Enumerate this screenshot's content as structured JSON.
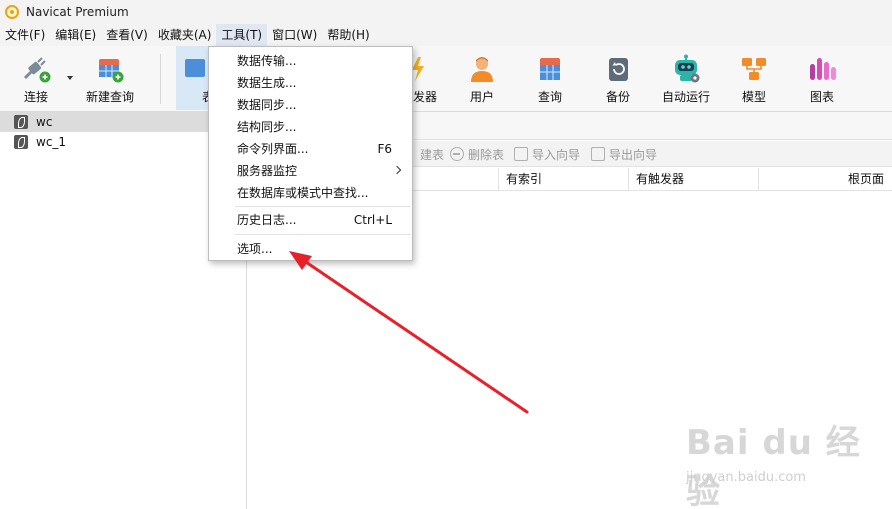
{
  "window": {
    "title": "Navicat Premium"
  },
  "menubar": {
    "items": [
      "文件(F)",
      "编辑(E)",
      "查看(V)",
      "收藏夹(A)",
      "工具(T)",
      "窗口(W)",
      "帮助(H)"
    ],
    "active_index": 4
  },
  "toolbar": {
    "buttons": [
      {
        "label": "连接",
        "icon": "connection-plug-icon"
      },
      {
        "label": "新建查询",
        "icon": "new-query-icon"
      },
      {
        "label": "表",
        "icon": "table-icon"
      },
      {
        "label": "发器",
        "icon": "trigger-icon"
      },
      {
        "label": "用户",
        "icon": "user-icon"
      },
      {
        "label": "查询",
        "icon": "query-icon"
      },
      {
        "label": "备份",
        "icon": "backup-icon"
      },
      {
        "label": "自动运行",
        "icon": "robot-icon"
      },
      {
        "label": "模型",
        "icon": "model-icon"
      },
      {
        "label": "图表",
        "icon": "chart-icon"
      }
    ]
  },
  "navigator": {
    "connections": [
      {
        "label": "wc",
        "selected": true
      },
      {
        "label": "wc_1",
        "selected": false
      }
    ]
  },
  "object_toolbar": {
    "new_table": "建表",
    "delete_table": "删除表",
    "import_wizard": "导入向导",
    "export_wizard": "导出向导"
  },
  "columns": {
    "has_index": "有索引",
    "has_trigger": "有触发器",
    "root_page": "根页面"
  },
  "tools_menu": {
    "items": [
      {
        "label": "数据传输...",
        "shortcut": ""
      },
      {
        "label": "数据生成...",
        "shortcut": ""
      },
      {
        "label": "数据同步...",
        "shortcut": ""
      },
      {
        "label": "结构同步...",
        "shortcut": ""
      },
      {
        "label": "命令列界面...",
        "shortcut": "F6"
      },
      {
        "label": "服务器监控",
        "shortcut": ""
      },
      {
        "label": "在数据库或模式中查找...",
        "shortcut": ""
      },
      {
        "label": "历史日志...",
        "shortcut": "Ctrl+L"
      },
      {
        "label": "选项...",
        "shortcut": ""
      }
    ]
  },
  "colors": {
    "annotation_arrow": "#e8202a",
    "menu_active_bg": "#dfe7f2",
    "selected_row_bg": "#dcdcdc"
  },
  "watermark": {
    "logo": "Bai du 经验",
    "url": "jingyan.baidu.com"
  }
}
